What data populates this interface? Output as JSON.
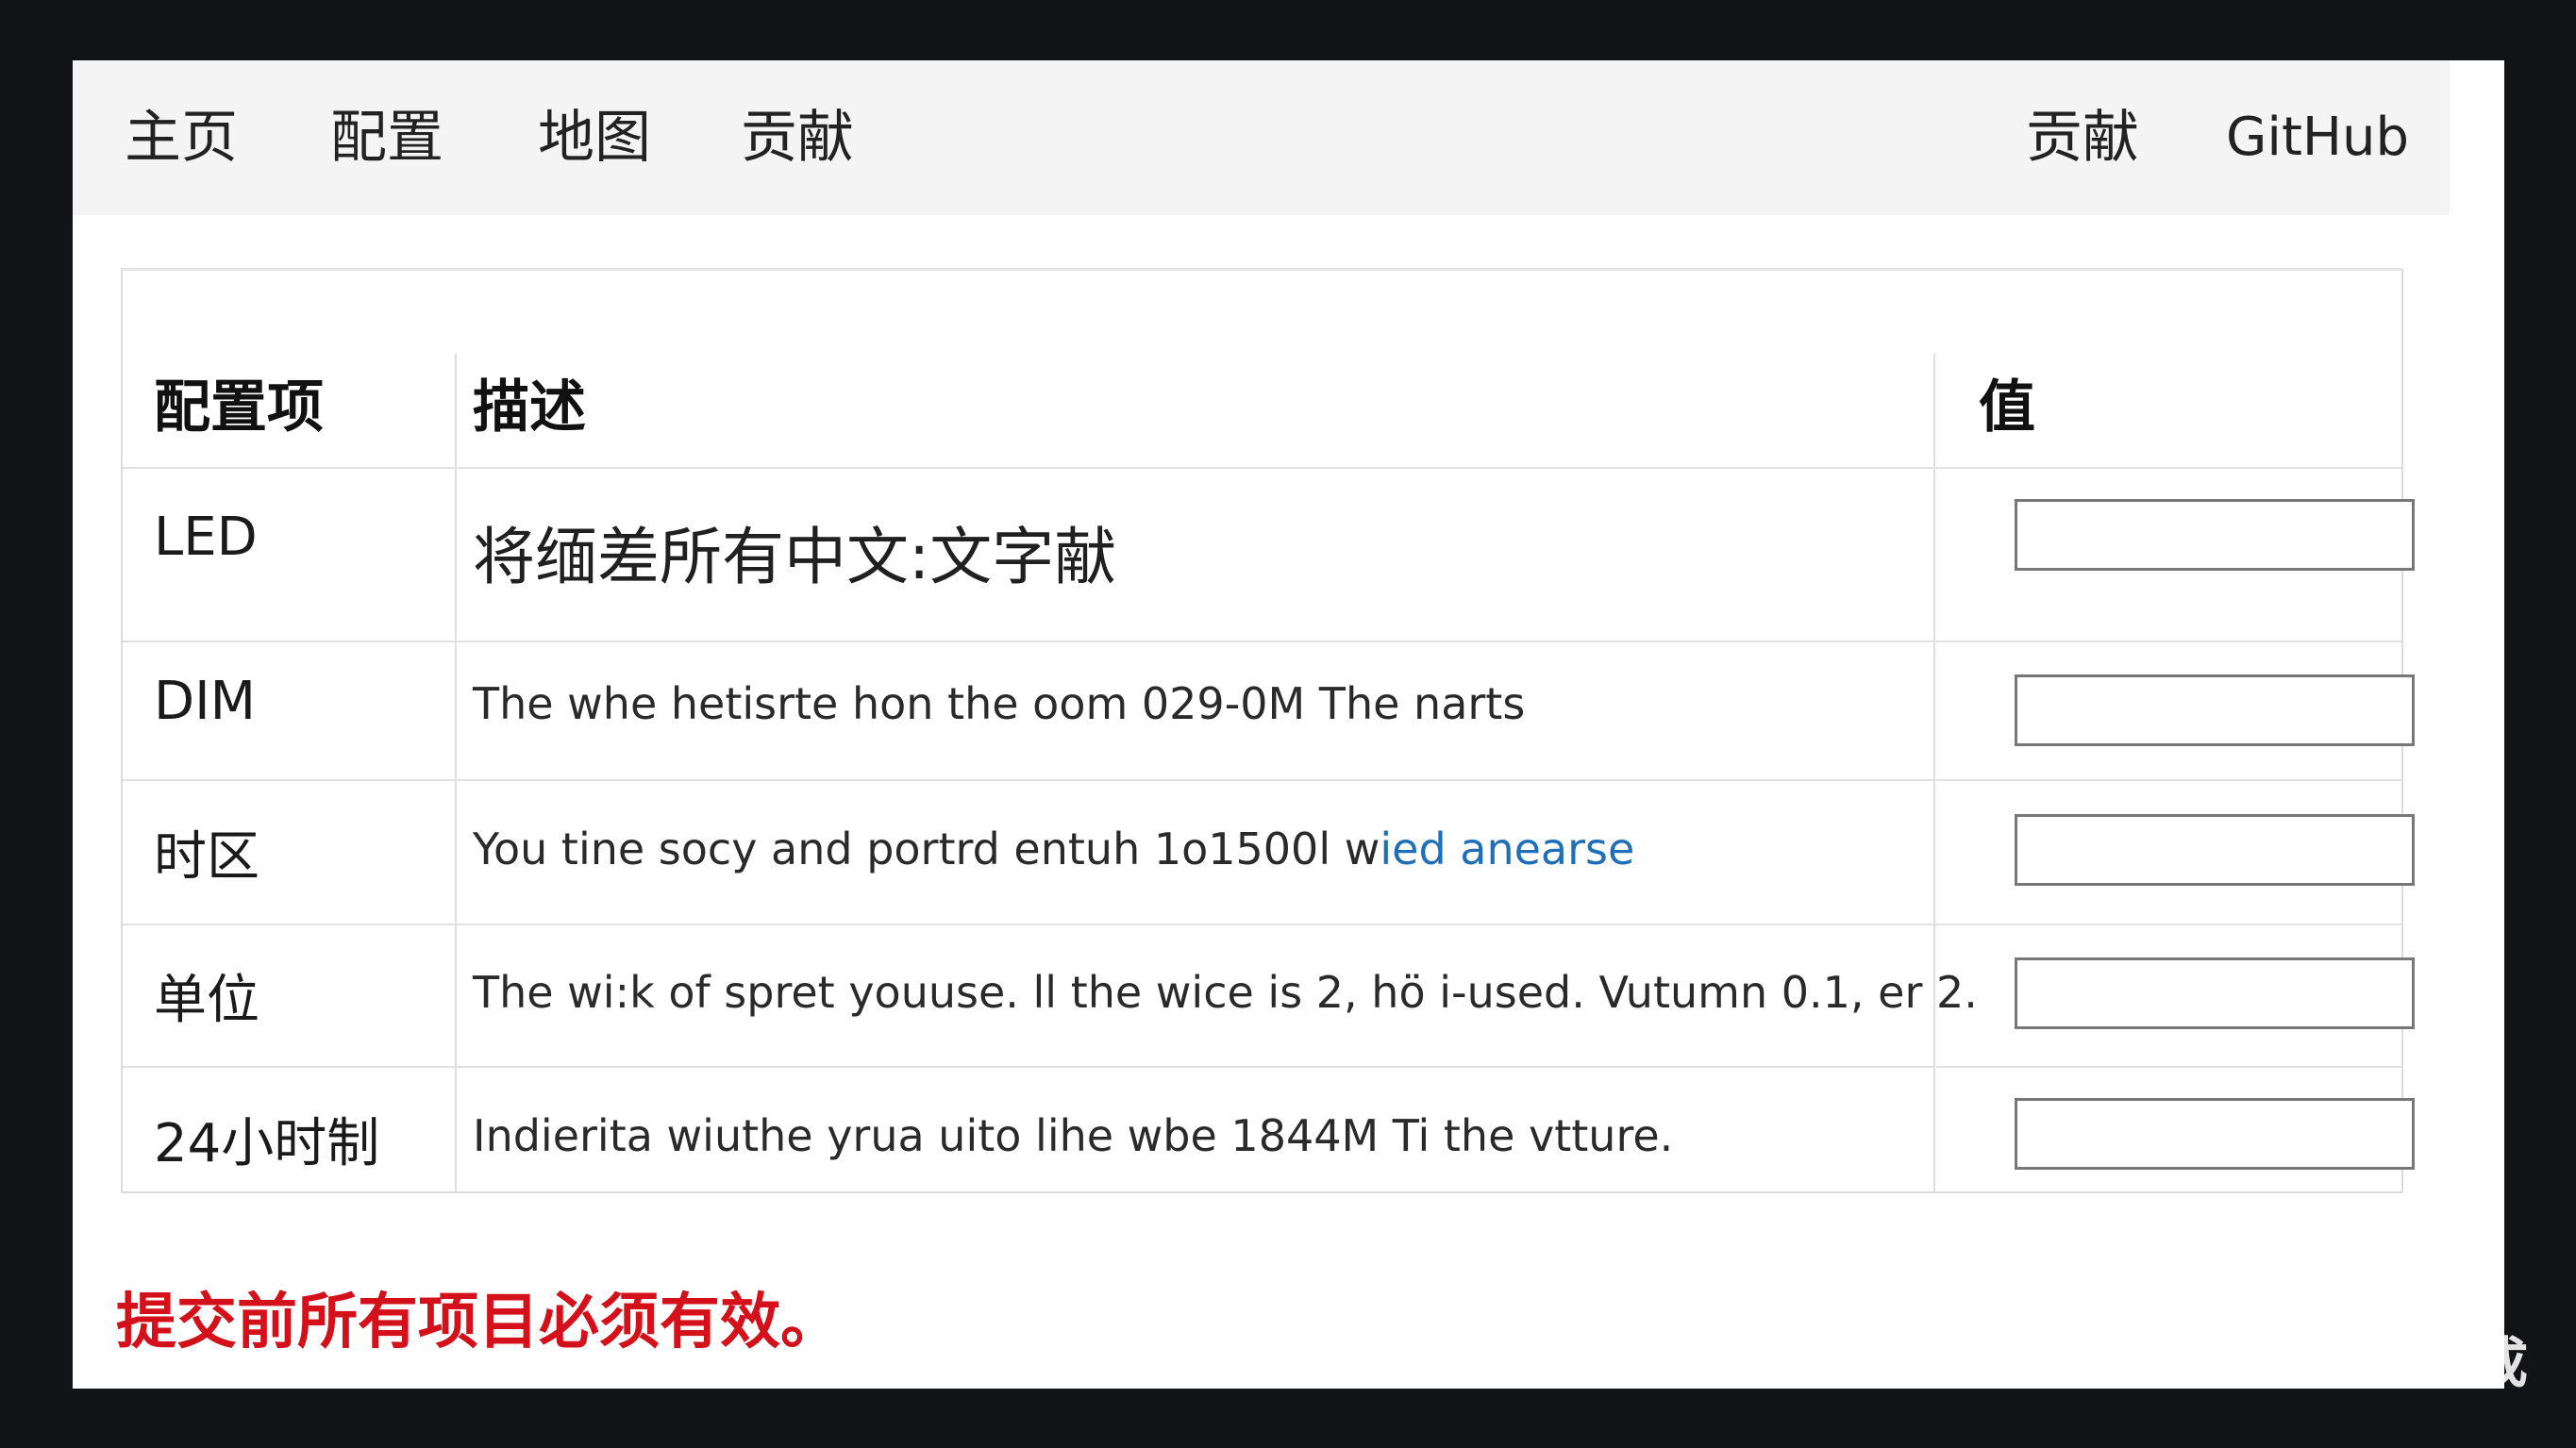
{
  "nav": {
    "left": [
      "主页",
      "配置",
      "地图",
      "贡献"
    ],
    "right": [
      "贡献",
      "GitHub"
    ]
  },
  "table": {
    "headers": {
      "key": "配置项",
      "description": "描述",
      "value": "值"
    },
    "rows": [
      {
        "key": "LED",
        "description": "将缅差所有中文:文字献",
        "description_link": "",
        "value": ""
      },
      {
        "key": "DIM",
        "description": "The whe hetisrte hon the oom 029-0M The narts",
        "description_link": "",
        "value": ""
      },
      {
        "key": "时区",
        "description": "You tine socy and portrd entuh 1o1500l w",
        "description_link": "ied anearse",
        "value": ""
      },
      {
        "key": "单位",
        "description": "The wi:k of spret youuse. ll the wice is 2, hö i-used. Vutumn 0.1, er 2.",
        "description_link": "",
        "value": ""
      },
      {
        "key": "24小时制",
        "description": "Indierita wiuthe yrua uito lihe wbe 1844M Ti the vtture.",
        "description_link": "",
        "value": ""
      }
    ]
  },
  "notice": "提交前所有项目必须有效。",
  "watermark": "豆包AI生成",
  "colors": {
    "notice": "#d4111a",
    "link": "#1f6fb8",
    "navbar_bg": "#f4f4f4",
    "frame_bg": "#121316"
  }
}
